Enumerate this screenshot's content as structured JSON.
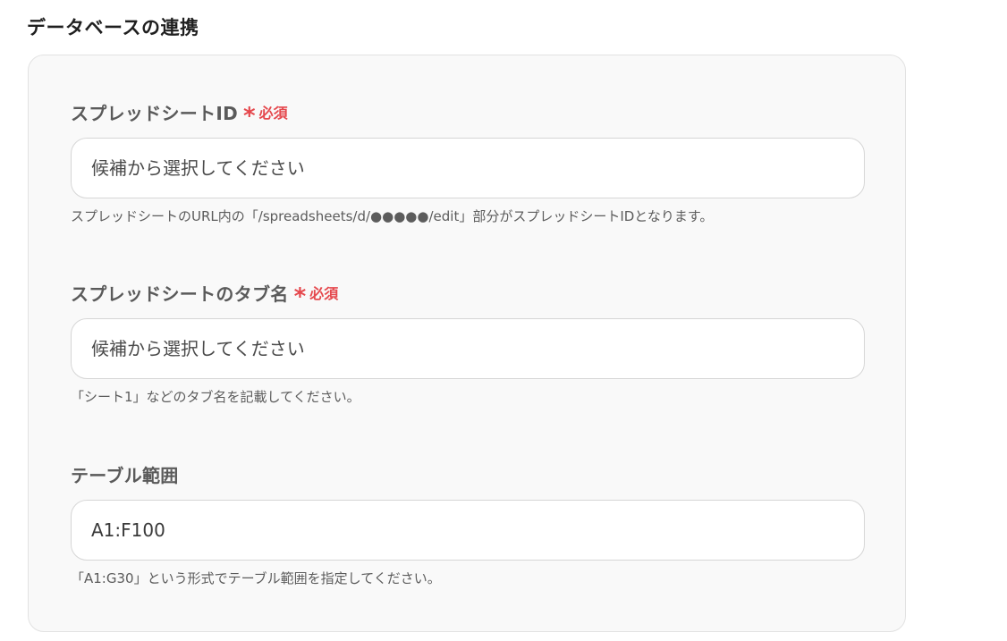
{
  "section": {
    "title": "データベースの連携"
  },
  "colors": {
    "required": "#e5484d",
    "panel_bg": "#f9f9f9",
    "panel_border": "#e2e2e2"
  },
  "fields": [
    {
      "label": "スプレッドシートID",
      "required": true,
      "required_mark": "*",
      "required_text": "必須",
      "value": "",
      "placeholder": "候補から選択してください",
      "hint": "スプレッドシートのURL内の「/spreadsheets/d/●●●●●/edit」部分がスプレッドシートIDとなります。"
    },
    {
      "label": "スプレッドシートのタブ名",
      "required": true,
      "required_mark": "*",
      "required_text": "必須",
      "value": "",
      "placeholder": "候補から選択してください",
      "hint": "「シート1」などのタブ名を記載してください。"
    },
    {
      "label": "テーブル範囲",
      "required": false,
      "value": "A1:F100",
      "placeholder": "",
      "hint": "「A1:G30」という形式でテーブル範囲を指定してください。"
    }
  ]
}
